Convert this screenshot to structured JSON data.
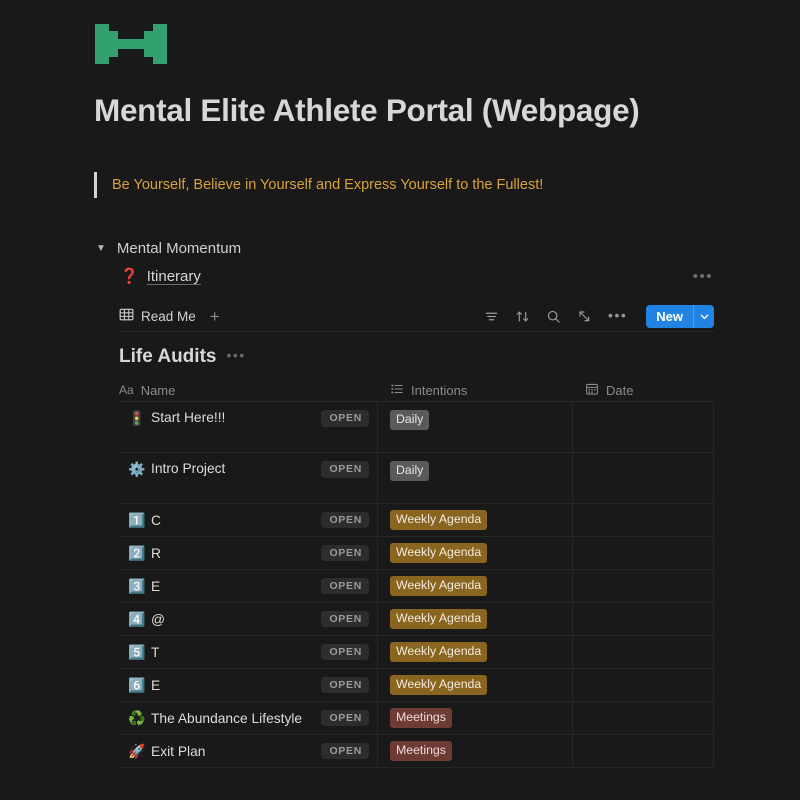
{
  "header": {
    "logo_icon": "dumbbell-logo",
    "logo_color": "#33a06f",
    "title": "Mental Elite Athlete Portal (Webpage)"
  },
  "quote": {
    "text": "Be Yourself, Believe in Yourself and Express Yourself to the Fullest!",
    "color": "#d9a13c"
  },
  "toggle": {
    "arrow_icon": "triangle-down-icon",
    "label": "Mental Momentum"
  },
  "itinerary": {
    "emoji": "❓",
    "label": "Itinerary",
    "more_label": "•••"
  },
  "db_toolbar": {
    "view_icon": "table-icon",
    "view_label": "Read Me",
    "add_label": "+",
    "icons": [
      {
        "name": "filter-icon",
        "label": "Filter"
      },
      {
        "name": "sort-icon",
        "label": "Sort"
      },
      {
        "name": "search-icon",
        "label": "Search"
      },
      {
        "name": "expand-icon",
        "label": "Expand"
      },
      {
        "name": "more-icon",
        "label": "•••"
      }
    ],
    "new_label": "New",
    "new_caret_icon": "chevron-down-icon",
    "new_color": "#2383e2"
  },
  "section": {
    "title": "Life Audits",
    "more_label": "•••"
  },
  "table": {
    "columns": [
      {
        "icon": "text-type-icon",
        "icon_glyph": "Aa",
        "label": "Name"
      },
      {
        "icon": "multiselect-icon",
        "icon_glyph": "",
        "label": "Intentions"
      },
      {
        "icon": "calendar-icon",
        "icon_glyph": "",
        "label": "Date"
      }
    ],
    "open_label": "OPEN",
    "rows": [
      {
        "emoji": "🚦",
        "emoji_name": "traffic-light-emoji",
        "name": "Start Here!!!",
        "open": "OPEN",
        "tag": "Daily",
        "tag_style": "tag-default",
        "date": "",
        "height": "tall"
      },
      {
        "emoji": "⚙️",
        "emoji_name": "gear-emoji",
        "name": "Intro Project",
        "open": "OPEN",
        "tag": "Daily",
        "tag_style": "tag-default",
        "date": "",
        "height": "tall"
      },
      {
        "emoji": "1️⃣",
        "emoji_name": "number-one-emoji",
        "name": "C",
        "open": "OPEN",
        "tag": "Weekly Agenda",
        "tag_style": "tag-orange",
        "date": "",
        "height": "short"
      },
      {
        "emoji": "2️⃣",
        "emoji_name": "number-two-emoji",
        "name": "R",
        "open": "OPEN",
        "tag": "Weekly Agenda",
        "tag_style": "tag-orange",
        "date": "",
        "height": "short"
      },
      {
        "emoji": "3️⃣",
        "emoji_name": "number-three-emoji",
        "name": "E",
        "open": "OPEN",
        "tag": "Weekly Agenda",
        "tag_style": "tag-orange",
        "date": "",
        "height": "short"
      },
      {
        "emoji": "4️⃣",
        "emoji_name": "number-four-emoji",
        "name": "@",
        "open": "OPEN",
        "tag": "Weekly Agenda",
        "tag_style": "tag-orange",
        "date": "",
        "height": "short"
      },
      {
        "emoji": "5️⃣",
        "emoji_name": "number-five-emoji",
        "name": "T",
        "open": "OPEN",
        "tag": "Weekly Agenda",
        "tag_style": "tag-orange",
        "date": "",
        "height": "short"
      },
      {
        "emoji": "6️⃣",
        "emoji_name": "number-six-emoji",
        "name": "E",
        "open": "OPEN",
        "tag": "Weekly Agenda",
        "tag_style": "tag-orange",
        "date": "",
        "height": "short"
      },
      {
        "emoji": "♻️",
        "emoji_name": "recycle-emoji",
        "name": "The Abundance Lifestyle",
        "open": "OPEN",
        "tag": "Meetings",
        "tag_style": "tag-red",
        "date": "",
        "height": "short"
      },
      {
        "emoji": "🚀",
        "emoji_name": "rocket-emoji",
        "name": "Exit Plan",
        "open": "OPEN",
        "tag": "Meetings",
        "tag_style": "tag-red",
        "date": "",
        "height": "short"
      }
    ]
  }
}
